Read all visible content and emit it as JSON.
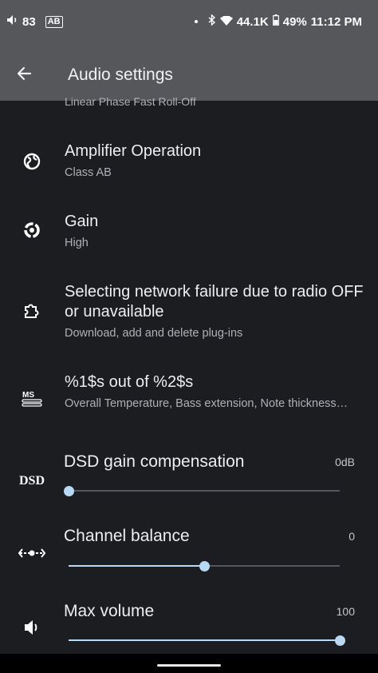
{
  "status_bar": {
    "volume": "83",
    "mode_badge": "AB",
    "sample_rate": "44.1K",
    "battery": "49%",
    "time": "11:12 PM"
  },
  "app_bar": {
    "title": "Audio settings"
  },
  "peek_row": {
    "subtitle": "Linear Phase Fast Roll-Off"
  },
  "rows": [
    {
      "title": "Amplifier Operation",
      "subtitle": "Class AB",
      "icon": "globe-icon"
    },
    {
      "title": "Gain",
      "subtitle": "High",
      "icon": "gain-icon"
    },
    {
      "title": "Selecting network failure due to radio OFF or unavailable",
      "subtitle": "Download, add and delete plug-ins",
      "icon": "puzzle-icon"
    },
    {
      "title": "%1$s out of %2$s",
      "subtitle": "Overall Temperature, Bass extension, Note thickness…",
      "icon": "ms-logo-icon"
    }
  ],
  "sliders": [
    {
      "title": "DSD gain compensation",
      "value_label": "0dB",
      "fraction": 0.0,
      "icon_text": "DSD"
    },
    {
      "title": "Channel balance",
      "value_label": "0",
      "fraction": 0.5,
      "icon": "balance-icon"
    },
    {
      "title": "Max volume",
      "value_label": "100",
      "fraction": 1.0,
      "icon": "speaker-icon"
    }
  ],
  "colors": {
    "accent": "#b8d8f3",
    "background": "#1b1d20",
    "app_bar": "#55575a"
  }
}
